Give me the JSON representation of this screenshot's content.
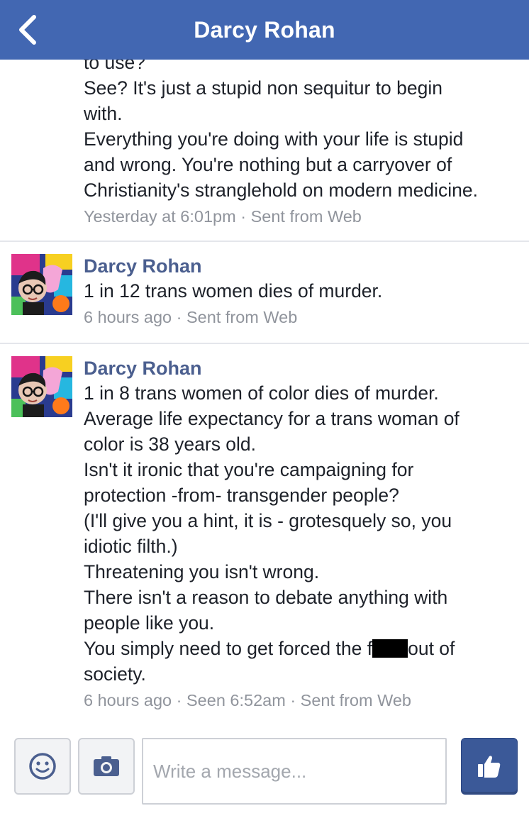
{
  "header": {
    "title": "Darcy Rohan"
  },
  "messages": [
    {
      "lines": [
        "to use?",
        "See? It's just a stupid non sequitur to begin",
        "with.",
        "Everything you're doing with your life is stupid",
        "and wrong. You're nothing but a carryover of",
        "Christianity's stranglehold on modern medicine."
      ],
      "meta": "Yesterday at 6:01pm · Sent from Web"
    },
    {
      "sender": "Darcy Rohan",
      "lines": [
        "1 in 12 trans women dies of murder."
      ],
      "meta": "6 hours ago · Sent from Web"
    },
    {
      "sender": "Darcy Rohan",
      "lines": [
        "1 in 8 trans women of color dies of murder.",
        "Average life expectancy for a trans woman of",
        "color is 38 years old.",
        "Isn't it ironic that you're campaigning for",
        "protection -from- transgender people?",
        "(I'll give you a hint, it is - grotesquely so, you",
        "idiotic filth.)",
        "Threatening you isn't wrong.",
        "There isn't a reason to debate anything with",
        "people like you.",
        "You simply need to get forced the f",
        "out of",
        "society."
      ],
      "meta": "6 hours ago · Seen 6:52am · Sent from Web"
    }
  ],
  "composer": {
    "placeholder": "Write a message..."
  },
  "icons": {
    "back": "chevron-left-icon",
    "emoji": "smiley-icon",
    "camera": "camera-icon",
    "like": "thumbs-up-icon"
  },
  "colors": {
    "header": "#4267b2",
    "sender": "#4b5f8f",
    "meta": "#90949c",
    "like_button": "#3b5998"
  }
}
